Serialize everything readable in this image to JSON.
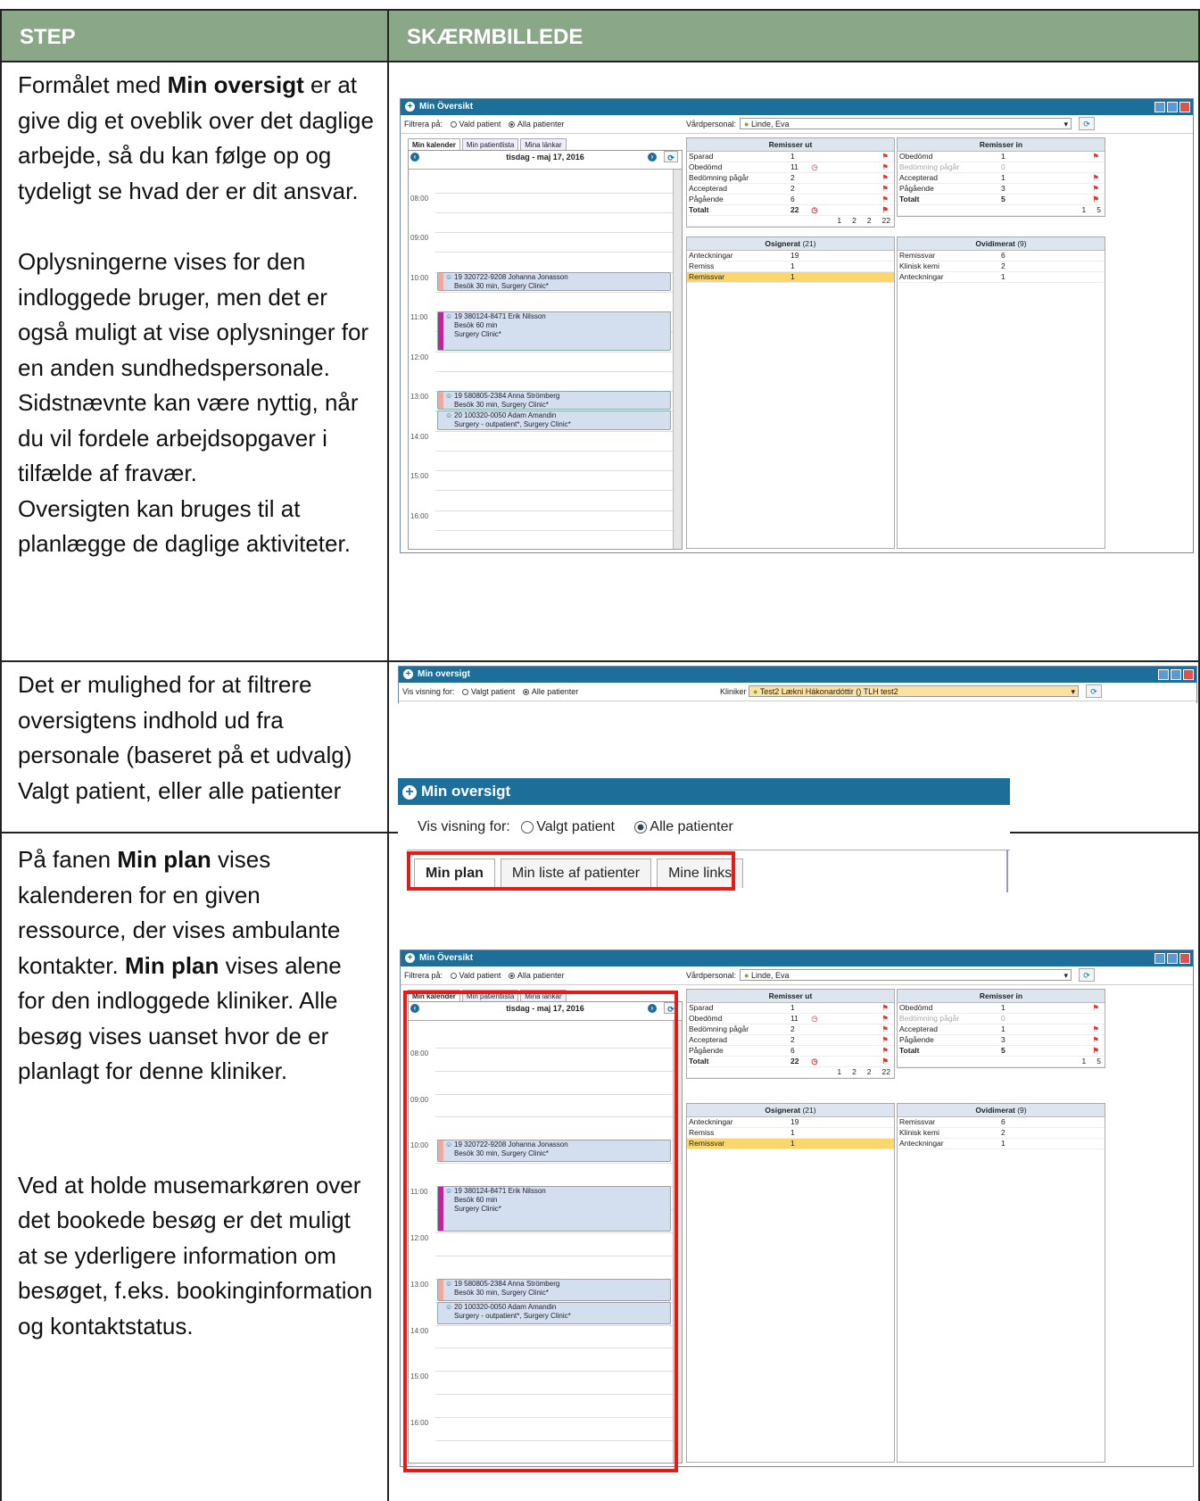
{
  "header": {
    "step": "STEP",
    "screenshot": "SKÆRMBILLEDE"
  },
  "rows": [
    {
      "paragraphs": [
        [
          "Formålet med ",
          "Min oversigt",
          " er at give dig et oveblik over det daglige arbejde, så du kan følge op og tydeligt se hvad der er dit ansvar."
        ],
        [
          "Oplysningerne vises for den indloggede bruger, men det er også muligt at vise oplysninger for en anden sundhedspersonale. Sidstnævnte kan være nyttig, når du vil fordele arbejdsopgaver i tilfælde af fravær."
        ],
        [
          "Oversigten kan bruges til at planlægge de daglige aktiviteter."
        ]
      ]
    },
    {
      "paragraphs": [
        [
          "Det er mulighed for at filtrere oversigtens indhold ud fra personale (baseret på et udvalg) Valgt patient, eller alle patienter"
        ]
      ]
    },
    {
      "paragraphs": [
        [
          "På fanen ",
          "Min plan",
          " vises kalenderen for en given ressource, der vises ambulante kontakter. ",
          "Min plan",
          " vises alene for den indloggede kliniker. Alle besøg vises uanset hvor de er planlagt for denne kliniker."
        ],
        [
          "Ved at holde musemarkøren over det bookede besøg er det muligt at se yderligere information om besøget, f.eks. bookinginformation og kontaktstatus."
        ]
      ]
    }
  ],
  "overview_window": {
    "title": "Min Översikt",
    "filter_label": "Filtrera på:",
    "opt_patient": "Vald patient",
    "opt_all": "Alla patienter",
    "staff_label": "Vårdpersonal:",
    "staff_value": "Linde, Eva",
    "tabs": [
      "Min kalender",
      "Min patientlista",
      "Mina länkar"
    ],
    "date": "tisdag - maj 17, 2016",
    "hours": [
      "08:00",
      "09:00",
      "10:00",
      "11:00",
      "12:00",
      "13:00",
      "14:00",
      "15:00",
      "16:00"
    ],
    "appointments": [
      {
        "l1": "19 320722-9208 Johanna Jonasson",
        "l2": "Besök 30 min, Surgery Clinic*",
        "l3": ""
      },
      {
        "l1": "19 380124-8471 Erik Nilsson",
        "l2": "Besök 60 min",
        "l3": "Surgery Clinic*"
      },
      {
        "l1": "19 580805-2384 Anna Strömberg",
        "l2": "Besök 30 min, Surgery Clinic*",
        "l3": ""
      },
      {
        "l1": "20 100320-0050 Adam Amandin",
        "l2": "Surgery - outpatient*, Surgery Clinic*",
        "l3": ""
      }
    ],
    "remisser_ut": {
      "title": "Remisser ut",
      "rows": [
        [
          "Sparad",
          "1"
        ],
        [
          "Obedömd",
          "11"
        ],
        [
          "Bedömning pågår",
          "2"
        ],
        [
          "Accepterad",
          "2"
        ],
        [
          "Pågående",
          "6"
        ],
        [
          "Totalt",
          "22"
        ]
      ],
      "sub": [
        "1",
        "2",
        "2",
        "22"
      ]
    },
    "remisser_in": {
      "title": "Remisser in",
      "rows": [
        [
          "Obedömd",
          "1"
        ],
        [
          "Bedömning pågår",
          "0"
        ],
        [
          "Accepterad",
          "1"
        ],
        [
          "Pågående",
          "3"
        ],
        [
          "Totalt",
          "5"
        ]
      ],
      "sub": [
        "1",
        "5"
      ]
    },
    "osignerat": {
      "title": "Osignerat",
      "count": "(21)",
      "rows": [
        [
          "Anteckningar",
          "19"
        ],
        [
          "Remiss",
          "1"
        ],
        [
          "Remissvar",
          "1"
        ]
      ]
    },
    "ovidimerat": {
      "title": "Ovidimerat",
      "count": "(9)",
      "rows": [
        [
          "Remissvar",
          "6"
        ],
        [
          "Klinisk kemi",
          "2"
        ],
        [
          "Anteckningar",
          "1"
        ]
      ]
    }
  },
  "filter_window": {
    "title": "Min oversigt",
    "label": "Vis visning for:",
    "opt_patient": "Valgt patient",
    "opt_all": "Alle patienter",
    "staff_label": "Kliniker",
    "staff_value": "Test2 Lækni Hákonardóttir () TLH test2"
  },
  "plan_window": {
    "title": "Min oversigt",
    "label": "Vis visning for:",
    "opt_patient": "Valgt patient",
    "opt_all": "Alle patienter",
    "tabs": [
      "Min plan",
      "Min liste af patienter",
      "Mine links"
    ]
  },
  "colors": {
    "header_bg": "#8aa888",
    "titlebar": "#1d6f9a",
    "highlight": "#e41b17"
  }
}
